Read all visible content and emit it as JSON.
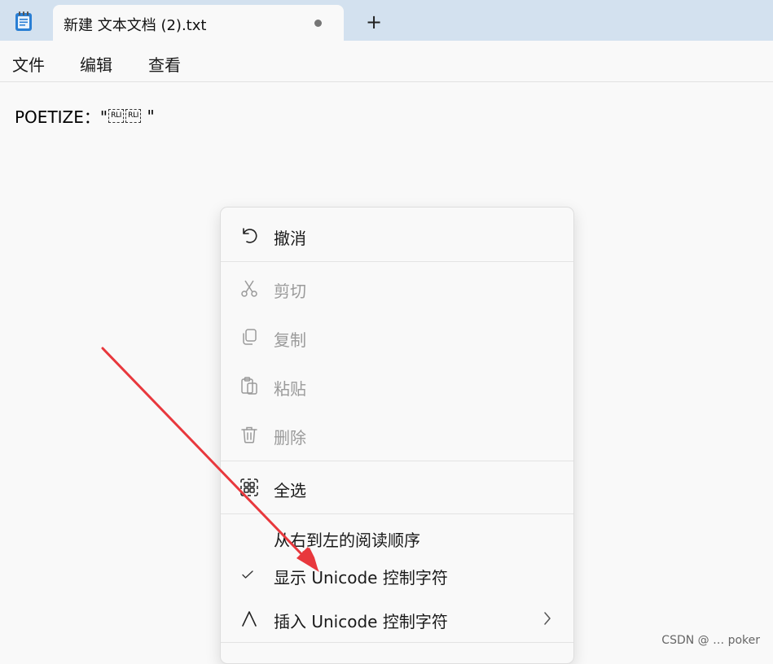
{
  "tab": {
    "title": "新建 文本文档 (2).txt",
    "new_tab_symbol": "+"
  },
  "menubar": {
    "file": "文件",
    "edit": "编辑",
    "view": "查看"
  },
  "editor": {
    "text_prefix": "POETIZE：\"",
    "control_chars": [
      "RLI",
      "RLI"
    ],
    "text_suffix": " \""
  },
  "context_menu": {
    "items": [
      {
        "label": "撤消",
        "icon": "undo-icon",
        "enabled": true
      },
      {
        "label": "剪切",
        "icon": "cut-icon",
        "enabled": false
      },
      {
        "label": "复制",
        "icon": "copy-icon",
        "enabled": false
      },
      {
        "label": "粘贴",
        "icon": "paste-icon",
        "enabled": false
      },
      {
        "label": "删除",
        "icon": "delete-icon",
        "enabled": false
      },
      {
        "label": "全选",
        "icon": "select-all-icon",
        "enabled": true
      },
      {
        "label": "从右到左的阅读顺序",
        "icon": "",
        "enabled": true
      },
      {
        "label": "显示 Unicode 控制字符",
        "icon": "checkmark-icon",
        "checked": true,
        "enabled": true
      },
      {
        "label": "插入 Unicode 控制字符",
        "icon": "caret-icon",
        "has_submenu": true,
        "enabled": true
      }
    ]
  },
  "watermark": "CSDN @ …  poker",
  "colors": {
    "tabstrip": "#d3e1ef",
    "background": "#f9f9f9",
    "arrow": "#e8383d",
    "disabled_text": "#9a9a9a"
  }
}
